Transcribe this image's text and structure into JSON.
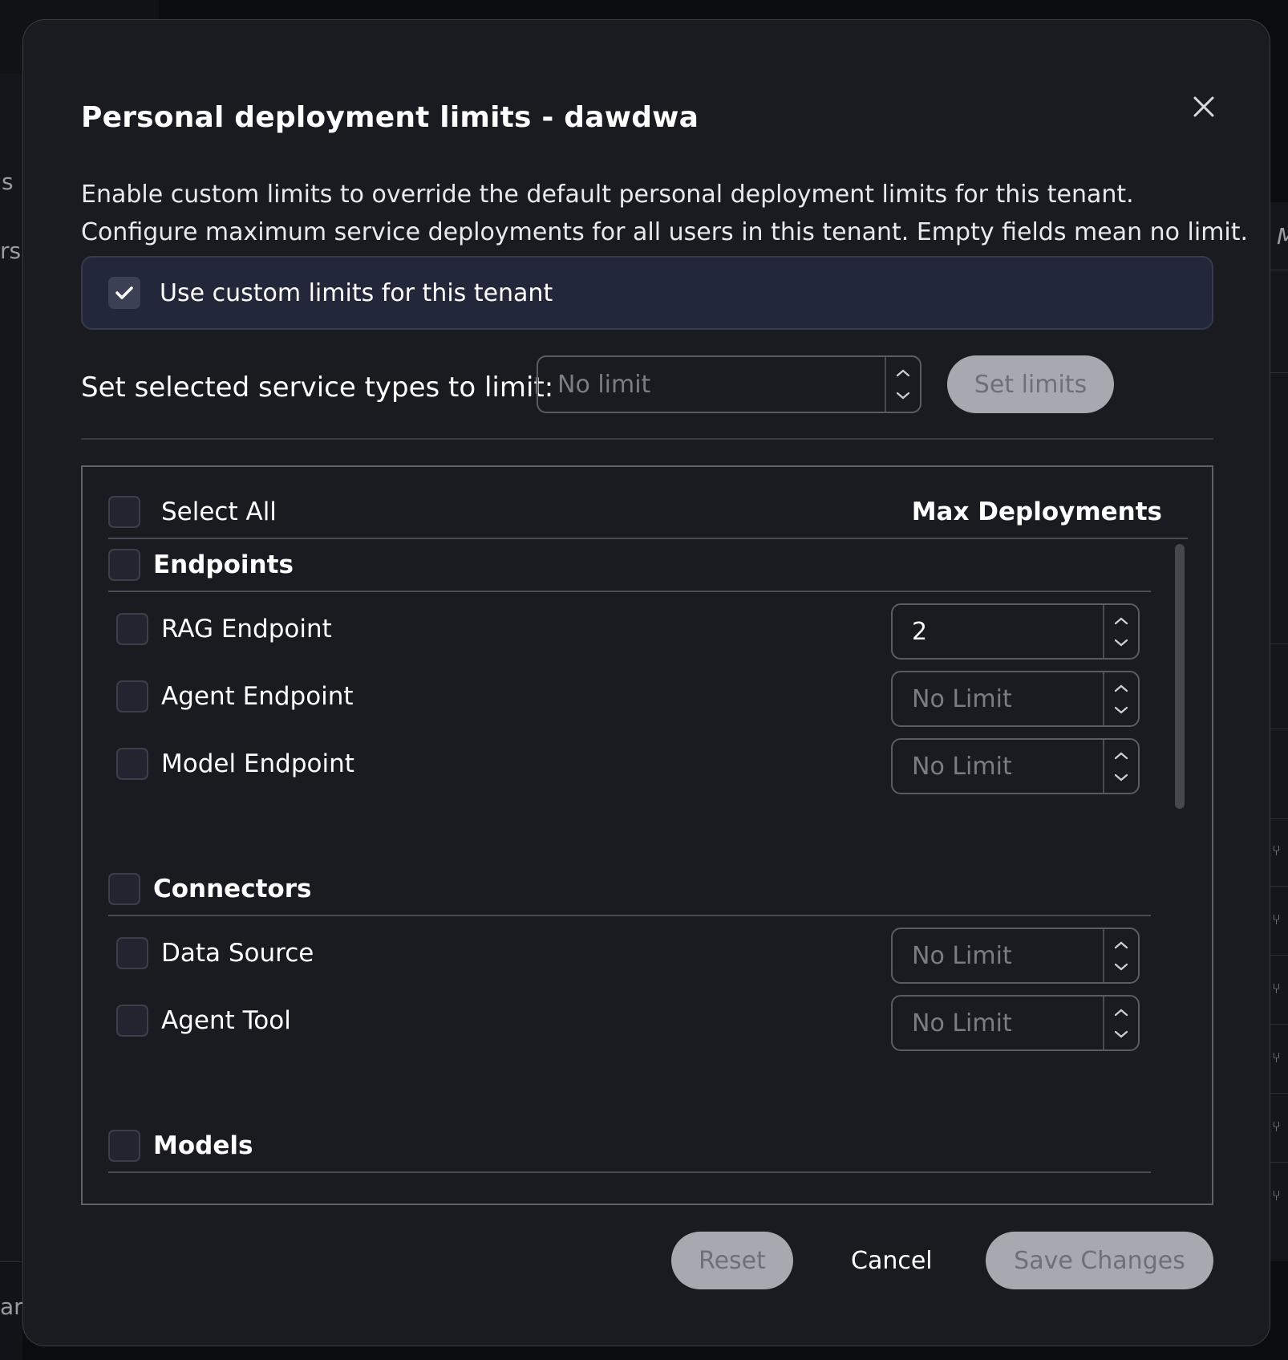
{
  "dialog": {
    "title": "Personal deployment limits - dawdwa",
    "description_line1": "Enable custom limits to override the default personal deployment limits for this tenant.",
    "description_line2": "Configure maximum service deployments for all users in this tenant. Empty fields mean no limit.",
    "custom_limits": {
      "label": "Use custom limits for this tenant",
      "checked": true
    },
    "bulk": {
      "label": "Set selected service types to limit:",
      "placeholder": "No limit",
      "button": "Set limits"
    },
    "table": {
      "select_all": "Select All",
      "max_header": "Max Deployments",
      "groups": [
        {
          "name": "Endpoints",
          "items": [
            {
              "label": "RAG Endpoint",
              "value": "2",
              "placeholder": "No Limit"
            },
            {
              "label": "Agent Endpoint",
              "value": "",
              "placeholder": "No Limit"
            },
            {
              "label": "Model Endpoint",
              "value": "",
              "placeholder": "No Limit"
            }
          ]
        },
        {
          "name": "Connectors",
          "items": [
            {
              "label": "Data Source",
              "value": "",
              "placeholder": "No Limit"
            },
            {
              "label": "Agent Tool",
              "value": "",
              "placeholder": "No Limit"
            }
          ]
        },
        {
          "name": "Models",
          "items": []
        }
      ]
    },
    "footer": {
      "reset": "Reset",
      "cancel": "Cancel",
      "save": "Save Changes"
    }
  },
  "background": {
    "fragment1": "s",
    "fragment2": "rs",
    "fragment3": "ar",
    "fragment4": "M"
  },
  "colors": {
    "modal_bg": "#1a1b21",
    "disabled_button": "#a8a9b0",
    "custom_box_bg": "#23273a"
  }
}
